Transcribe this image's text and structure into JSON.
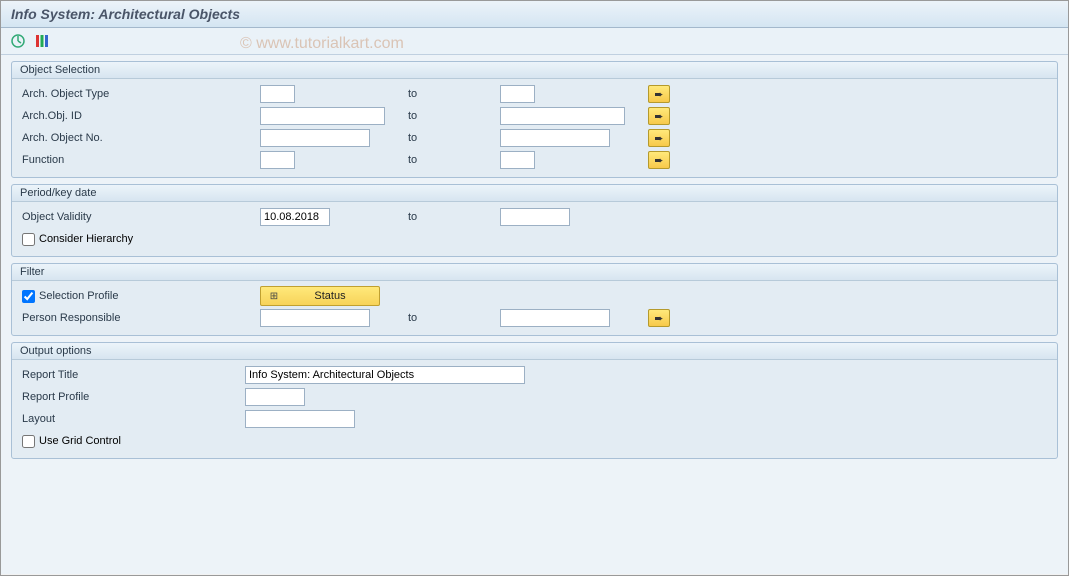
{
  "title": "Info System: Architectural Objects",
  "watermark": "© www.tutorialkart.com",
  "common": {
    "to_label": "to"
  },
  "groups": {
    "object_selection": {
      "title": "Object Selection",
      "rows": {
        "arch_object_type": {
          "label": "Arch. Object Type",
          "from": "",
          "to": ""
        },
        "arch_obj_id": {
          "label": "Arch.Obj. ID",
          "from": "",
          "to": ""
        },
        "arch_object_no": {
          "label": "Arch. Object No.",
          "from": "",
          "to": ""
        },
        "function": {
          "label": "Function",
          "from": "",
          "to": ""
        }
      }
    },
    "period": {
      "title": "Period/key date",
      "rows": {
        "object_validity": {
          "label": "Object Validity",
          "from": "10.08.2018",
          "to": ""
        }
      },
      "consider_hierarchy": {
        "label": "Consider Hierarchy",
        "checked": false
      }
    },
    "filter": {
      "title": "Filter",
      "selection_profile": {
        "label": "Selection Profile",
        "checked": true,
        "button_label": "Status"
      },
      "person_responsible": {
        "label": "Person Responsible",
        "from": "",
        "to": ""
      }
    },
    "output": {
      "title": "Output options",
      "report_title": {
        "label": "Report Title",
        "value": "Info System: Architectural Objects"
      },
      "report_profile": {
        "label": "Report Profile",
        "value": ""
      },
      "layout": {
        "label": "Layout",
        "value": ""
      },
      "use_grid": {
        "label": "Use Grid Control",
        "checked": false
      }
    }
  }
}
